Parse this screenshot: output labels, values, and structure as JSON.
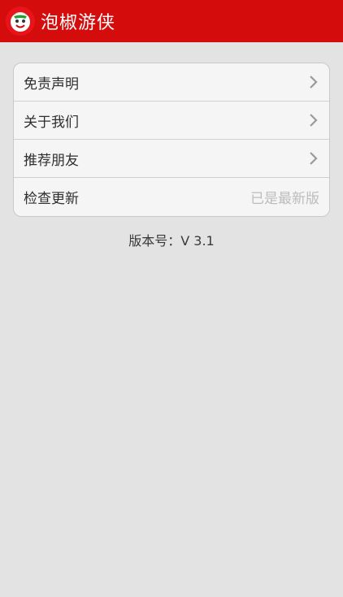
{
  "app": {
    "title": "泡椒游侠",
    "logo_icon": "chili-mascot-icon"
  },
  "colors": {
    "appbar": "#d40c0c",
    "background": "#e3e3e3",
    "card": "#f5f5f5"
  },
  "menu": {
    "items": [
      {
        "label": "免责声明",
        "trailing": "chevron-right-icon"
      },
      {
        "label": "关于我们",
        "trailing": "chevron-right-icon"
      },
      {
        "label": "推荐朋友",
        "trailing": "chevron-right-icon"
      },
      {
        "label": "检查更新",
        "status": "已是最新版"
      }
    ]
  },
  "version": {
    "text": "版本号：V 3.1"
  }
}
